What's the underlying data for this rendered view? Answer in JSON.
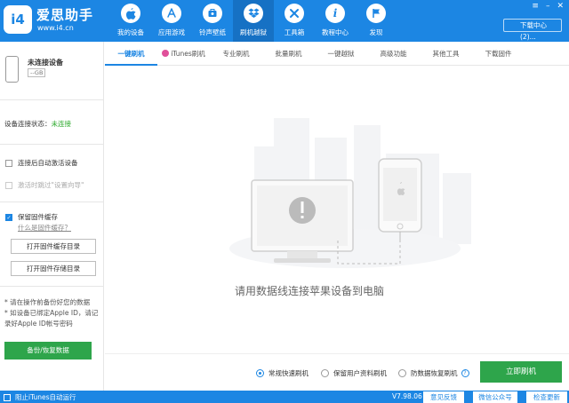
{
  "header": {
    "brand_name": "爱思助手",
    "brand_url": "www.i4.cn",
    "logo_text": "i4",
    "nav": [
      {
        "label": "我的设备",
        "icon": "apple-icon"
      },
      {
        "label": "应用游戏",
        "icon": "app-store-icon"
      },
      {
        "label": "铃声壁纸",
        "icon": "ringtone-icon"
      },
      {
        "label": "刷机越狱",
        "icon": "dropbox-icon",
        "active": true
      },
      {
        "label": "工具箱",
        "icon": "tools-icon"
      },
      {
        "label": "教程中心",
        "icon": "info-icon"
      },
      {
        "label": "发现",
        "icon": "flag-icon"
      }
    ],
    "download_center": "下载中心(2)..."
  },
  "sidebar": {
    "device_name": "未连接设备",
    "device_capacity": "--GB",
    "conn_label": "设备连接状态：",
    "conn_value": "未连接",
    "auto_activate": "连接后自动激活设备",
    "skip_guide": "激活时跳过\"设置向导\"",
    "keep_cache": "保留固件缓存",
    "what_is_cache": "什么是固件缓存？",
    "open_cache_dir": "打开固件缓存目录",
    "open_storage_dir": "打开固件存储目录",
    "note_1": "* 请在操作前备份好您的数据",
    "note_2": "* 如设备已绑定Apple ID，请记录好Apple ID帐号密码",
    "backup_restore": "备份/恢复数据"
  },
  "tabs": [
    {
      "label": "一键刷机",
      "active": true
    },
    {
      "label": "iTunes刷机"
    },
    {
      "label": "专业刷机"
    },
    {
      "label": "批量刷机"
    },
    {
      "label": "一键越狱"
    },
    {
      "label": "高级功能"
    },
    {
      "label": "其他工具"
    },
    {
      "label": "下载固件"
    }
  ],
  "main": {
    "hint": "请用数据线连接苹果设备到电脑"
  },
  "options": {
    "radio_quick": "常规快速刷机",
    "radio_keep": "保留用户资料刷机",
    "radio_antirecovery": "防数据恢复刷机",
    "flash_now": "立即刷机"
  },
  "statusbar": {
    "block_itunes": "阻止iTunes自动运行",
    "version": "V7.98.06",
    "feedback": "意见反馈",
    "wechat": "微信公众号",
    "check_update": "检查更新"
  },
  "colors": {
    "primary": "#1c86e3",
    "green": "#2ea54b"
  }
}
